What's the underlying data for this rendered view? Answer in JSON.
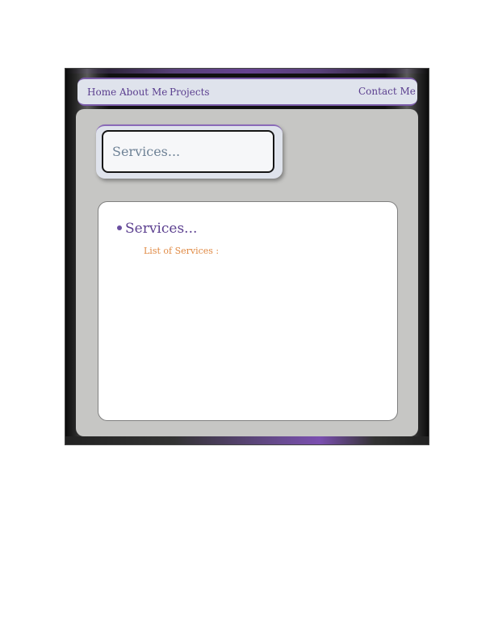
{
  "nav": {
    "items": [
      {
        "label": "Home"
      },
      {
        "label": "About Me"
      },
      {
        "label": "Projects"
      }
    ],
    "contact_label": "Contact Me"
  },
  "title_card": {
    "title": "Services..."
  },
  "main": {
    "heading": "Services...",
    "list_label": "List of Services :"
  },
  "colors": {
    "nav_text": "#5b3f8f",
    "accent_purple": "#6a4c93",
    "label_orange": "#e08a44",
    "panel_gray": "#c6c6c4",
    "frame_dark": "#111111"
  }
}
